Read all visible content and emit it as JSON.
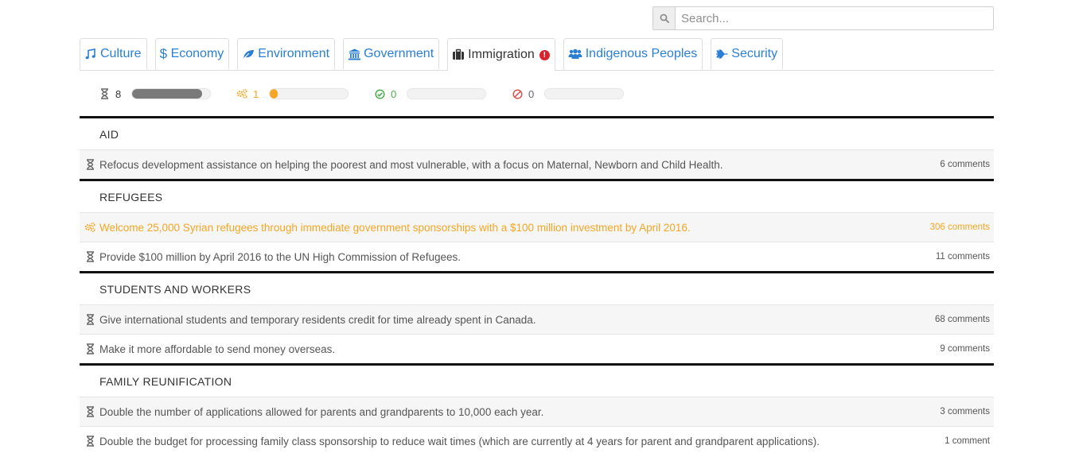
{
  "search": {
    "placeholder": "Search..."
  },
  "tabs": [
    {
      "label": "Culture",
      "icon": "music-icon"
    },
    {
      "label": "Economy",
      "icon": "dollar-icon"
    },
    {
      "label": "Environment",
      "icon": "leaf-icon"
    },
    {
      "label": "Government",
      "icon": "bank-icon"
    },
    {
      "label": "Immigration",
      "icon": "briefcase-icon",
      "active": true,
      "alert": "!"
    },
    {
      "label": "Indigenous Peoples",
      "icon": "users-icon"
    },
    {
      "label": "Security",
      "icon": "plane-icon"
    }
  ],
  "status": {
    "pending": {
      "count": "8",
      "fill": 0.9,
      "color": "#7a7a7a"
    },
    "in_progress": {
      "count": "1",
      "fill": 0.1,
      "color": "#f5a623"
    },
    "completed": {
      "count": "0",
      "fill": 0,
      "color": "#4cae4c"
    },
    "broken": {
      "count": "0",
      "fill": 0,
      "color": "#d9534f"
    }
  },
  "sections": [
    {
      "title": "AID",
      "items": [
        {
          "text": "Refocus development assistance on helping the poorest and most vulnerable, with a focus on Maternal, Newborn and Child Health.",
          "comments": "6 comments",
          "status": "pending"
        }
      ]
    },
    {
      "title": "REFUGEES",
      "items": [
        {
          "text": "Welcome 25,000 Syrian refugees through immediate government sponsorships with a $100 million investment by April 2016.",
          "comments": "306 comments",
          "status": "in_progress"
        },
        {
          "text": "Provide $100 million by April 2016 to the UN High Commission of Refugees.",
          "comments": "11 comments",
          "status": "pending"
        }
      ]
    },
    {
      "title": "STUDENTS AND WORKERS",
      "items": [
        {
          "text": "Give international students and temporary residents credit for time already spent in Canada.",
          "comments": "68 comments",
          "status": "pending"
        },
        {
          "text": "Make it more affordable to send money overseas.",
          "comments": "9 comments",
          "status": "pending"
        }
      ]
    },
    {
      "title": "FAMILY REUNIFICATION",
      "items": [
        {
          "text": "Double the number of applications allowed for parents and grandparents to 10,000 each year.",
          "comments": "3 comments",
          "status": "pending"
        },
        {
          "text": "Double the budget for processing family class sponsorship to reduce wait times (which are currently at 4 years for parent and grandparent applications).",
          "comments": "1 comment",
          "status": "pending"
        }
      ]
    }
  ]
}
